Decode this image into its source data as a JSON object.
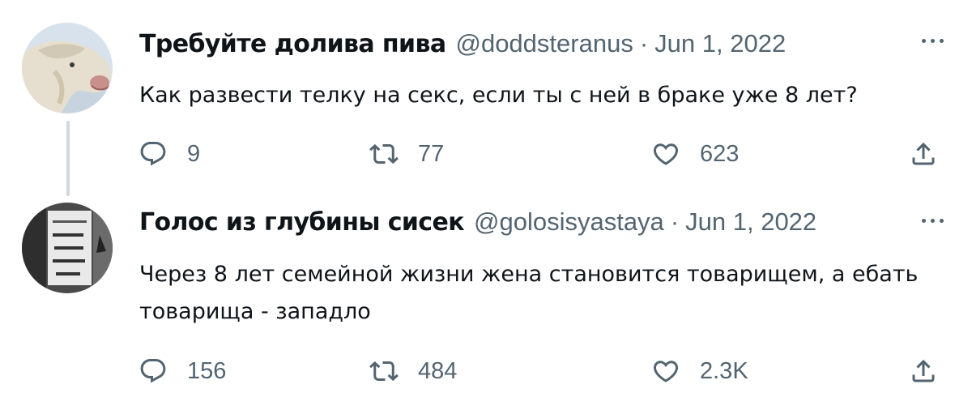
{
  "tweets": [
    {
      "display_name": "Требуйте долива пива",
      "handle": "@doddsteranus",
      "separator": "·",
      "date": "Jun 1, 2022",
      "text": "Как развести телку на секс, если ты с ней в браке уже 8 лет?",
      "replies": "9",
      "retweets": "77",
      "likes": "623",
      "avatar_icon": "horse-avatar-image"
    },
    {
      "display_name": "Голос из глубины сисек",
      "handle": "@golosisyastaya",
      "separator": "·",
      "date": "Jun 1, 2022",
      "text": "Через 8 лет семейной жизни жена становится товарищем, а ебать товарища - западло",
      "replies": "156",
      "retweets": "484",
      "likes": "2.3K",
      "avatar_icon": "sign-photo-avatar-image"
    }
  ],
  "colors": {
    "text": "#0f1419",
    "secondary": "#536471",
    "thread_line": "#cfd9de",
    "background": "#ffffff"
  },
  "icons": [
    "reply-icon",
    "retweet-icon",
    "like-icon",
    "share-icon",
    "more-options-icon"
  ]
}
